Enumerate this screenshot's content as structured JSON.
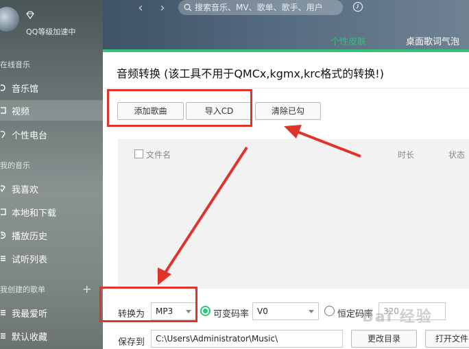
{
  "sidebar": {
    "vip_text": "QQ等级加速中",
    "sections": [
      "在线音乐",
      "我的音乐",
      "我创建的歌单"
    ],
    "online_items": [
      "音乐馆",
      "视频",
      "个性电台"
    ],
    "my_items": [
      "我喜欢",
      "本地和下载",
      "播放历史",
      "试听列表"
    ],
    "playlist_items": [
      "我最爱听",
      "默认收藏"
    ],
    "add_symbol": "+"
  },
  "topbar": {
    "back_arrow": "‹",
    "forward_arrow": "›",
    "search_placeholder": "搜索音乐、MV、歌单、歌手、用户",
    "green_link": "个性皮肤",
    "lyrics_link": "桌面歌词气泡"
  },
  "dialog": {
    "title": "音频转换 (该工具不用于QMCx,kgmx,krc格式的转换!)",
    "buttons": {
      "add_song": "添加歌曲",
      "import_cd": "导入CD",
      "clear_checked": "清除已勾"
    },
    "columns": {
      "filename": "文件名",
      "duration": "时长",
      "status": "状态"
    },
    "convert_to_label": "转换为",
    "format_value": "MP3",
    "vbr_label": "可变码率",
    "vbr_value": "V0",
    "cbr_label": "恒定码率",
    "cbr_value": "320",
    "save_to_label": "保存到",
    "save_path": "C:\\Users\\Administrator\\Music\\",
    "change_dir_label": "更改目录",
    "open_folder_label": "打开文件"
  },
  "watermark": "Bai 经验",
  "colors": {
    "accent": "#31c27c",
    "annotation": "#e0332c"
  }
}
